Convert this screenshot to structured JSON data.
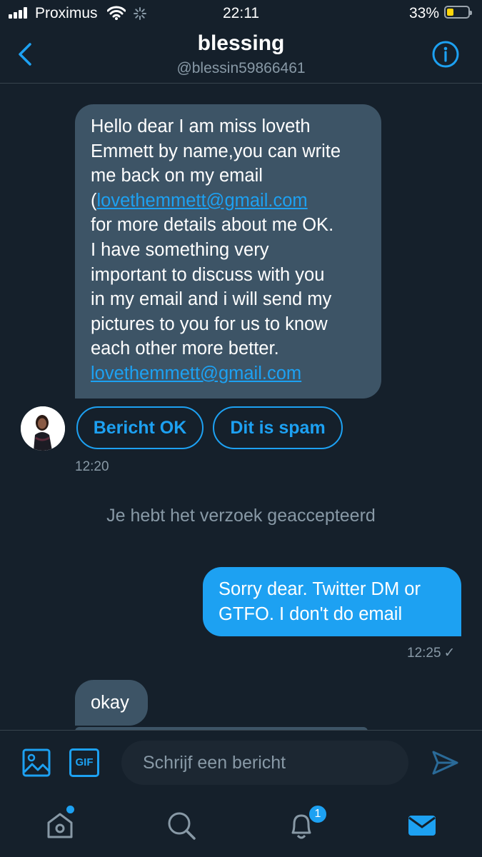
{
  "status_bar": {
    "carrier": "Proximus",
    "time": "22:11",
    "battery_percent": "33%",
    "battery_level": 0.33
  },
  "header": {
    "name": "blessing",
    "handle": "@blessin59866461",
    "back_icon": "chevron-left-icon",
    "info_icon": "info-icon"
  },
  "messages": {
    "incoming_1": {
      "line_1": "Hello dear I am miss loveth",
      "line_2": "Emmett by name,you can write",
      "line_3": "me back on my email",
      "line_4_prefix": "(",
      "line_4_link": "lovethemmett@gmail.com",
      "line_5": "for more details about me OK.",
      "line_6": "I have something very",
      "line_7": "important to discuss with you",
      "line_8": "in my email and i will send my",
      "line_9": "pictures to you for us to know",
      "line_10": "each other more better.",
      "line_11_link": "lovethemmett@gmail.com",
      "time": "12:20"
    },
    "actions": {
      "ok_label": "Bericht OK",
      "spam_label": "Dit is spam"
    },
    "system_note": "Je hebt het verzoek geaccepteerd",
    "outgoing_1": {
      "line_1": "Sorry dear. Twitter DM or",
      "line_2": "GTFO. I don't do email",
      "time": "12:25",
      "check": "✓"
    },
    "incoming_2": {
      "text": "okay"
    }
  },
  "composer": {
    "placeholder": "Schrijf een bericht",
    "gif_label": "GIF"
  },
  "tab_bar": {
    "notifications_badge": "1"
  },
  "colors": {
    "background": "#15202b",
    "accent": "#1da1f2",
    "incoming_bubble": "#3d5466",
    "muted_text": "#8899a6"
  }
}
